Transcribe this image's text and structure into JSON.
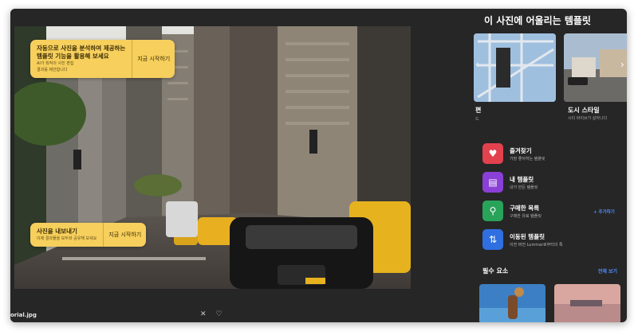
{
  "editor": {
    "filename": "orial.jpg",
    "tip_top": {
      "line1": "자동으로 사진을 분석하여 제공하는",
      "line2": "템플릿 기능을 활용해 보세요",
      "sub1": "AI가 최적의 사진 편집",
      "sub2": "결과를 제안합니다",
      "button": "지금 시작하기"
    },
    "tip_bottom": {
      "line1": "사진을 내보내기",
      "sub1": "이제 결과물을 모두와 공유해 보세요",
      "button": "지금 시작하기"
    },
    "bottom_icons": {
      "close": "✕",
      "heart": "♡"
    }
  },
  "panel": {
    "title": "이 사진에 어울리는 템플릿",
    "arrow_left": "‹",
    "arrow_right": "›",
    "templates": [
      {
        "name": "편",
        "desc": "드"
      },
      {
        "name": "도시 스타일",
        "desc": "시티 바이브가 살아나다"
      }
    ],
    "library": [
      {
        "name": "즐겨찾기",
        "desc": "가장 좋아하는 템플릿",
        "icon": "heart-icon",
        "color": "#e2414e",
        "glyph": "♥"
      },
      {
        "name": "내 템플릿",
        "desc": "내가 만든 템플릿",
        "icon": "my-templates-icon",
        "color": "#8a3fd6",
        "glyph": "▤"
      },
      {
        "name": "구매한 목록",
        "desc": "구매한 유료 템플릿",
        "icon": "purchased-icon",
        "color": "#29a35a",
        "glyph": "⚲"
      },
      {
        "name": "이동된 템플릿",
        "desc": "이전 버전 Luminar로부터의 톡",
        "icon": "migrated-icon",
        "color": "#2f6fe0",
        "glyph": "⇅"
      }
    ],
    "add_link": "+ 추가하기",
    "section_title": "필수 요소",
    "see_all": "전체 보기"
  }
}
